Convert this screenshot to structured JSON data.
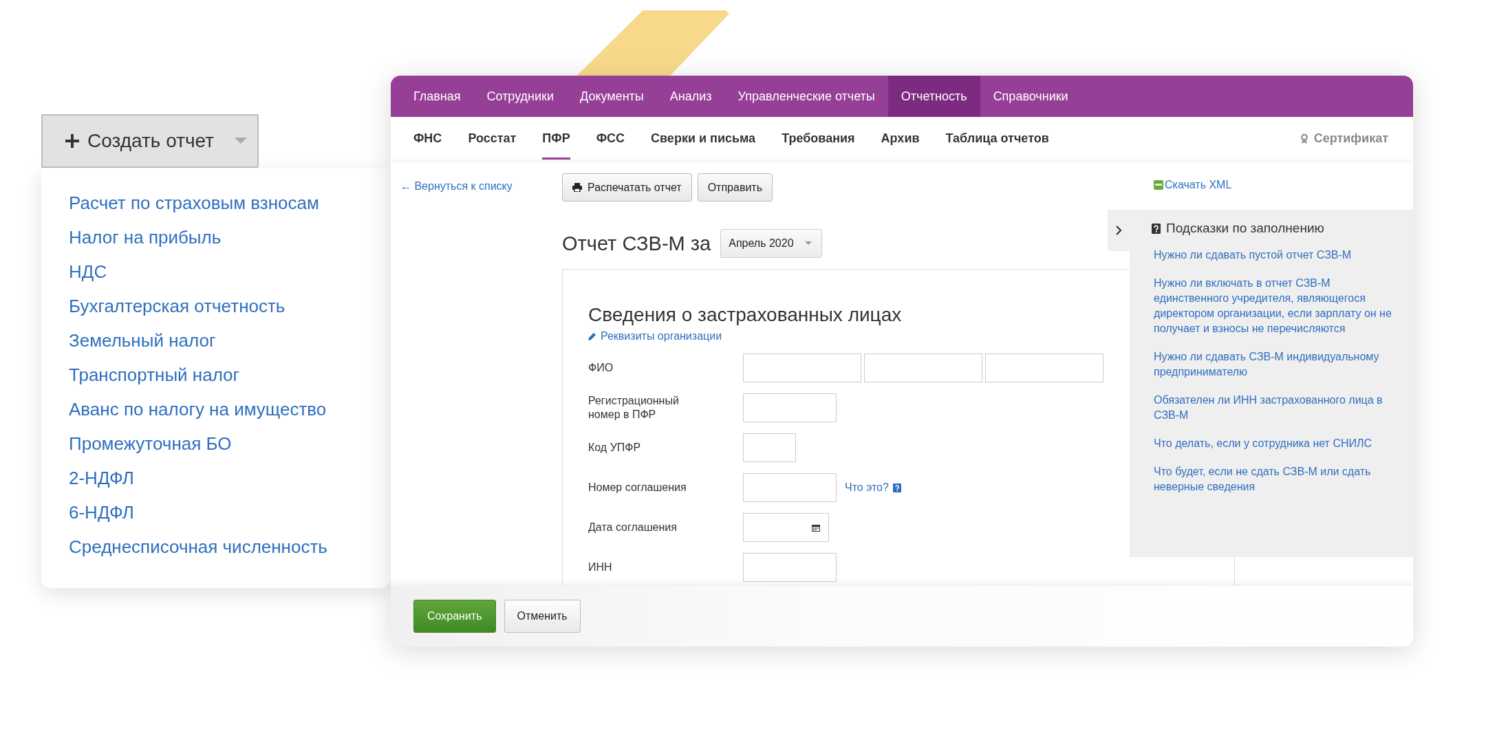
{
  "create_button": {
    "label": "Создать отчет"
  },
  "report_menu": {
    "items": [
      "Расчет по страховым взносам",
      "Налог на прибыль",
      "НДС",
      "Бухгалтерская отчетность",
      "Земельный налог",
      "Транспортный налог",
      "Аванс по налогу на имущество",
      "Промежуточная БО",
      "2-НДФЛ",
      "6-НДФЛ",
      "Среднесписочная численность"
    ]
  },
  "top_nav": [
    {
      "label": "Главная",
      "selected": false
    },
    {
      "label": "Сотрудники",
      "selected": false
    },
    {
      "label": "Документы",
      "selected": false
    },
    {
      "label": "Анализ",
      "selected": false
    },
    {
      "label": "Управленческие отчеты",
      "selected": false
    },
    {
      "label": "Отчетность",
      "selected": true
    },
    {
      "label": "Справочники",
      "selected": false
    }
  ],
  "sub_nav": [
    {
      "label": "ФНС",
      "selected": false
    },
    {
      "label": "Росстат",
      "selected": false
    },
    {
      "label": "ПФР",
      "selected": true
    },
    {
      "label": "ФСС",
      "selected": false
    },
    {
      "label": "Сверки и письма",
      "selected": false
    },
    {
      "label": "Требования",
      "selected": false
    },
    {
      "label": "Архив",
      "selected": false
    },
    {
      "label": "Таблица отчетов",
      "selected": false
    }
  ],
  "certificate": "Сертификат",
  "back_link": "← Вернуться к списку",
  "toolbar": [
    {
      "label": "Распечатать отчет",
      "kind": "print"
    },
    {
      "label": "Отправить",
      "kind": "plain"
    }
  ],
  "download_link": "Скачать XML",
  "report_title": "Отчет СЗВ-М за",
  "period_select": {
    "value": "Апрель 2020"
  },
  "form": {
    "title": "Сведения о застрахованных лицах",
    "org_link": "Реквизиты организации",
    "fields": [
      {
        "label": "ФИО",
        "kind": "triple"
      },
      {
        "label": "Регистрационный номер в ПФР",
        "kind": "text"
      },
      {
        "label": "Код УПФР",
        "kind": "short"
      },
      {
        "label": "Номер соглашения",
        "kind": "text",
        "help": "Что это?"
      },
      {
        "label": "Дата соглашения",
        "kind": "date"
      },
      {
        "label": "ИНН",
        "kind": "text"
      }
    ]
  },
  "hints": {
    "title": "Подсказки по заполнению",
    "items": [
      "Нужно ли сдавать пустой отчет СЗВ-М",
      "Нужно ли включать в отчет СЗВ-М единственного учредителя, являющегося директором организации, если зарплату он не получает и взносы не перечисляются",
      "Нужно ли сдавать СЗВ-М индивидуальному предпринимателю",
      "Обязателен ли ИНН застрахованного лица в СЗВ-М",
      "Что делать, если у сотрудника нет СНИЛС",
      "Что будет, если не сдать СЗВ-М или сдать неверные сведения"
    ]
  },
  "footer": [
    {
      "label": "Сохранить",
      "kind": "primary"
    },
    {
      "label": "Отменить",
      "kind": "secondary"
    }
  ]
}
